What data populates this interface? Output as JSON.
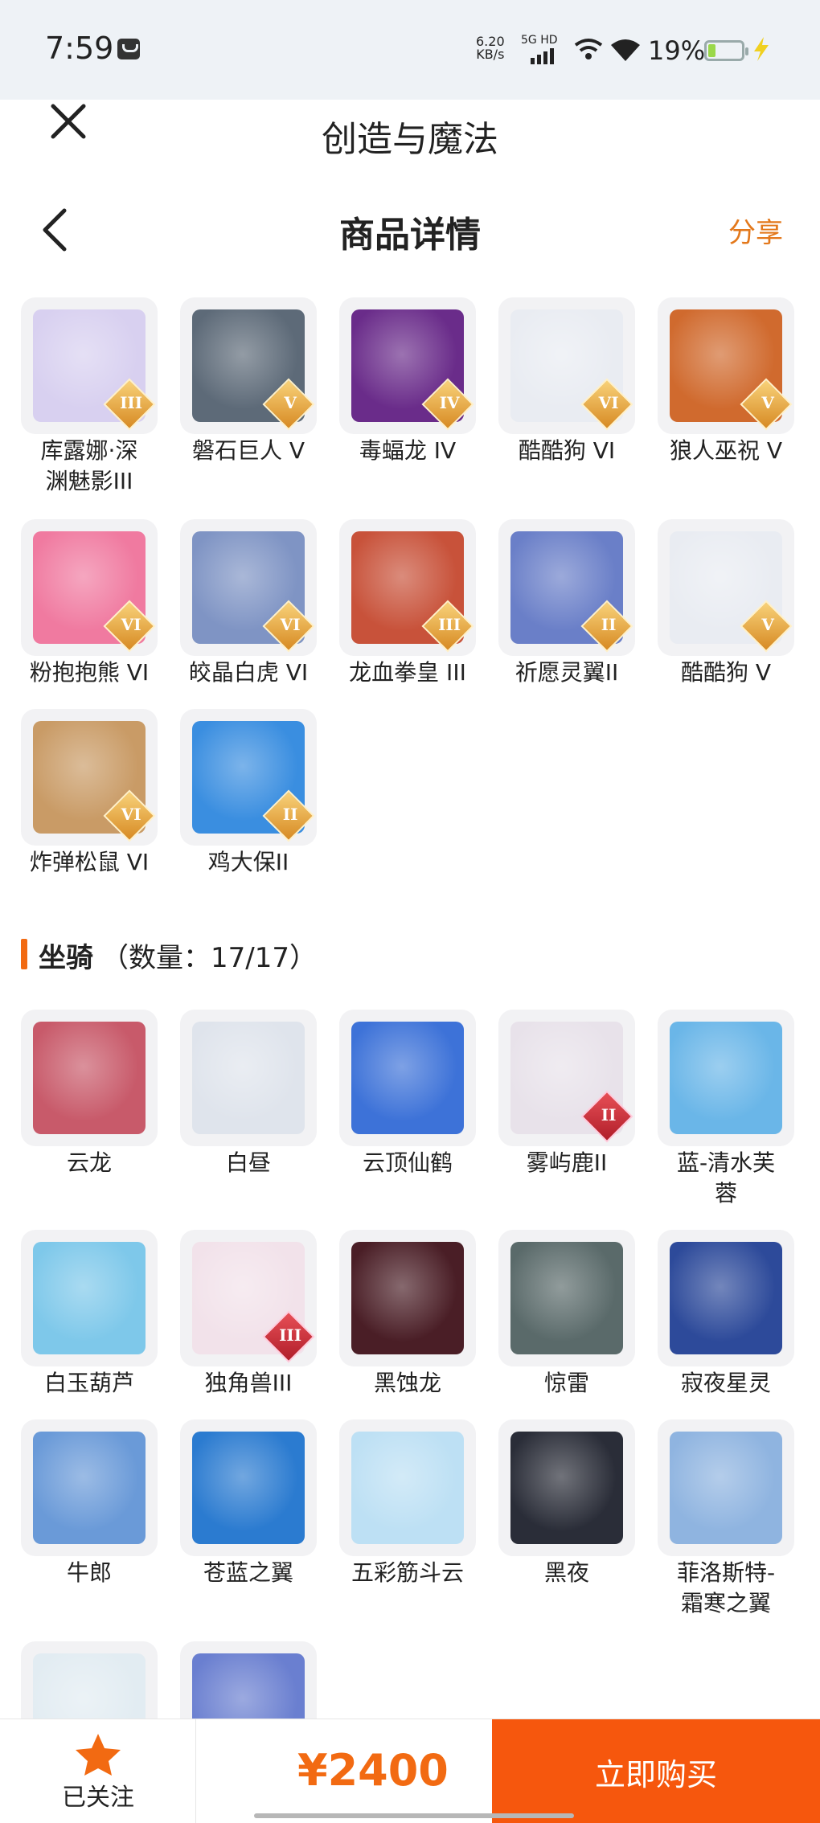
{
  "status_bar": {
    "time": "7:59",
    "net_speed_value": "6.20",
    "net_speed_unit": "KB/s",
    "network": "5G HD",
    "battery_percent": "19%",
    "battery_level": 0.19
  },
  "app_bar": {
    "title": "创造与魔法"
  },
  "header": {
    "title": "商品详情",
    "share_label": "分享"
  },
  "pets": [
    {
      "name": "库露娜·深",
      "name2": "渊魅影III",
      "badge": "III",
      "color": "#d8d0f0"
    },
    {
      "name": "磐石巨人 V",
      "badge": "V",
      "color": "#5d6a78"
    },
    {
      "name": "毒蝠龙 IV",
      "badge": "IV",
      "color": "#6a2c8a"
    },
    {
      "name": "酷酷狗 VI",
      "badge": "VI",
      "color": "#e9ecf2"
    },
    {
      "name": "狼人巫祝 V",
      "badge": "V",
      "color": "#d06a2e"
    },
    {
      "name": "粉抱抱熊 VI",
      "badge": "VI",
      "color": "#f07aa0"
    },
    {
      "name": "皎晶白虎 VI",
      "badge": "VI",
      "color": "#7f94c4"
    },
    {
      "name": "龙血拳皇 III",
      "badge": "III",
      "color": "#c8523a"
    },
    {
      "name": "祈愿灵翼II",
      "badge": "II",
      "color": "#6a7fc8"
    },
    {
      "name": "酷酷狗 V",
      "badge": "V",
      "color": "#e9ecf2"
    },
    {
      "name": "炸弹松鼠 VI",
      "badge": "VI",
      "color": "#c99b66"
    },
    {
      "name": "鸡大保II",
      "badge": "II",
      "color": "#3a8ee0"
    }
  ],
  "mounts_section": {
    "title": "坐骑",
    "count_text": "（数量：17/17）"
  },
  "mounts": [
    {
      "name": "云龙",
      "color": "#c85a6a"
    },
    {
      "name": "白昼",
      "color": "#dfe4ec"
    },
    {
      "name": "云顶仙鹤",
      "color": "#3d72d8"
    },
    {
      "name": "雾屿鹿II",
      "badge": "II",
      "color": "#e8e2ea"
    },
    {
      "name": "蓝-清水芙",
      "name2": "蓉",
      "color": "#6ab6e8"
    },
    {
      "name": "白玉葫芦",
      "color": "#7ec8ea"
    },
    {
      "name": "独角兽III",
      "badge": "III",
      "color": "#f2e2ea"
    },
    {
      "name": "黑蚀龙",
      "color": "#4a1e26"
    },
    {
      "name": "惊雷",
      "color": "#5a6a6a"
    },
    {
      "name": "寂夜星灵",
      "color": "#2d4a9a"
    },
    {
      "name": "牛郎",
      "color": "#6a9ad8"
    },
    {
      "name": "苍蓝之翼",
      "color": "#2b7bd0"
    },
    {
      "name": "五彩筋斗云",
      "color": "#bde0f4"
    },
    {
      "name": "黑夜",
      "color": "#2a2d38"
    },
    {
      "name": "菲洛斯特-",
      "name2": "霜寒之翼",
      "color": "#8fb4e0"
    },
    {
      "name": "",
      "color": "#e2ecf2"
    },
    {
      "name": "",
      "color": "#6a7fd0"
    }
  ],
  "bottom_bar": {
    "follow_label": "已关注",
    "price": "¥2400",
    "buy_label": "立即购买"
  },
  "colors": {
    "accent": "#f26a12",
    "buy_button": "#f6570d",
    "share": "#e3781b"
  }
}
